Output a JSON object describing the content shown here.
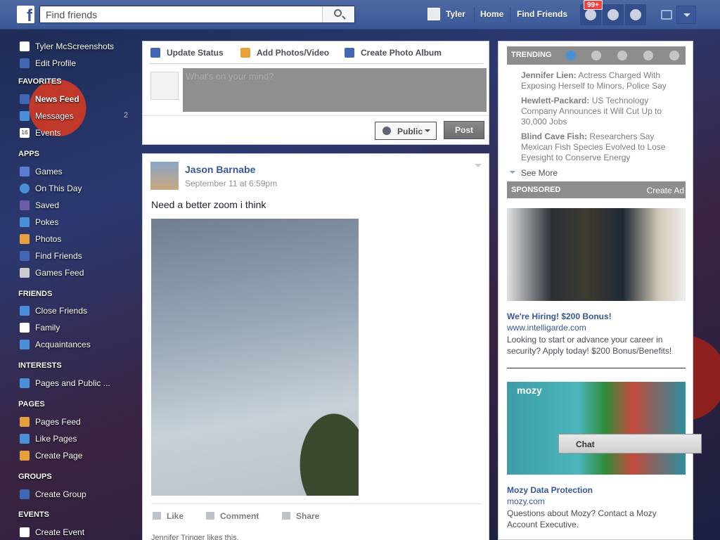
{
  "topbar": {
    "search_placeholder": "Find friends",
    "user_name": "Tyler",
    "home": "Home",
    "find_friends": "Find Friends",
    "notif_count": "99+"
  },
  "sidebar": {
    "profile_name": "Tyler McScreenshots",
    "edit_profile": "Edit Profile",
    "sections": {
      "favorites": "FAVORITES",
      "apps": "APPS",
      "friends": "FRIENDS",
      "interests": "INTERESTS",
      "pages": "PAGES",
      "groups": "GROUPS",
      "events": "EVENTS"
    },
    "favorites": [
      {
        "label": "News Feed",
        "icon": "news-feed-icon"
      },
      {
        "label": "Messages",
        "icon": "messages-icon",
        "count": "2"
      },
      {
        "label": "Events",
        "icon": "calendar-icon",
        "badge": "16"
      }
    ],
    "apps": [
      {
        "label": "Games",
        "icon": "games-icon"
      },
      {
        "label": "On This Day",
        "icon": "clock-icon"
      },
      {
        "label": "Saved",
        "icon": "bookmark-icon"
      },
      {
        "label": "Pokes",
        "icon": "poke-icon"
      },
      {
        "label": "Photos",
        "icon": "photos-icon"
      },
      {
        "label": "Find Friends",
        "icon": "find-friends-icon"
      },
      {
        "label": "Games Feed",
        "icon": "controller-icon"
      }
    ],
    "friends": [
      {
        "label": "Close Friends",
        "icon": "star-icon"
      },
      {
        "label": "Family",
        "icon": "house-icon"
      },
      {
        "label": "Acquaintances",
        "icon": "list-icon"
      }
    ],
    "interests": [
      {
        "label": "Pages and Public ...",
        "icon": "rss-icon"
      }
    ],
    "pages": [
      {
        "label": "Pages Feed",
        "icon": "pages-feed-icon"
      },
      {
        "label": "Like Pages",
        "icon": "thumbs-up-icon"
      },
      {
        "label": "Create Page",
        "icon": "flag-icon"
      }
    ],
    "groups": [
      {
        "label": "Create Group",
        "icon": "plus-icon"
      }
    ],
    "events": [
      {
        "label": "Create Event",
        "icon": "plus-calendar-icon"
      }
    ]
  },
  "composer": {
    "tab_status": "Update Status",
    "tab_photos": "Add Photos/Video",
    "tab_album": "Create Photo Album",
    "placeholder": "What's on your mind?",
    "privacy": "Public",
    "post": "Post"
  },
  "story": {
    "author": "Jason Barnabe",
    "time": "September 11 at 6:59pm",
    "text": "Need a better zoom i think",
    "like": "Like",
    "comment": "Comment",
    "share": "Share",
    "likes_line": "Jennifer Tringer likes this."
  },
  "trending": {
    "title": "TRENDING",
    "items": [
      {
        "topic": "Jennifer Lien:",
        "text": " Actress Charged With Exposing Herself to Minors, Police Say"
      },
      {
        "topic": "Hewlett-Packard:",
        "text": " US Technology Company Announces it Will Cut Up to 30,000 Jobs"
      },
      {
        "topic": "Blind Cave Fish:",
        "text": " Researchers Say Mexican Fish Species Evolved to Lose Eyesight to Conserve Energy"
      }
    ],
    "see_more": "See More"
  },
  "sponsored": {
    "title": "SPONSORED",
    "create_ad": "Create Ad",
    "ads": [
      {
        "title": "We're Hiring! $200 Bonus!",
        "url": "www.intelligarde.com",
        "body": "Looking to start or advance your career in security? Apply today! $200 Bonus/Benefits!"
      },
      {
        "brand": "mozy",
        "title": "Mozy Data Protection",
        "url": "mozy.com",
        "body": "Questions about Mozy? Contact a Mozy Account Executive."
      }
    ]
  },
  "chat": {
    "label": "Chat"
  },
  "colors": {
    "brand": "#3b5998",
    "link": "#365899",
    "badge": "#fa3e3e"
  }
}
